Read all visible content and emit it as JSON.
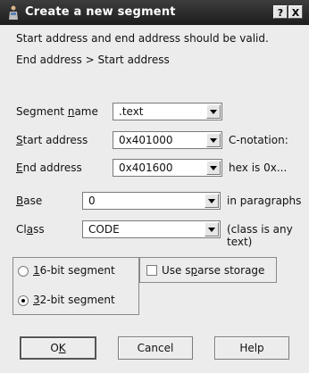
{
  "window": {
    "title": "Create a new segment",
    "help_label": "?",
    "close_label": "X"
  },
  "message": {
    "line1": "Start address and end address should be valid.",
    "line2": "End address > Start address"
  },
  "fields": {
    "segment_name": {
      "label_pre": "Segment ",
      "label_accel": "n",
      "label_post": "ame",
      "value": ".text"
    },
    "start_address": {
      "label_accel": "S",
      "label_post": "tart address",
      "value": "0x401000",
      "hint": "C-notation:"
    },
    "end_address": {
      "label_accel": "E",
      "label_post": "nd address",
      "value": "0x401600",
      "hint": "hex is 0x..."
    },
    "base": {
      "label_accel": "B",
      "label_post": "ase",
      "value": "0",
      "hint": "in paragraphs"
    },
    "class": {
      "label_pre": "Cl",
      "label_accel": "a",
      "label_post": "ss",
      "value": "CODE",
      "hint": "(class is any text)"
    }
  },
  "bitness": {
    "option16": {
      "label_accel": "1",
      "label_post": "6-bit segment",
      "selected": false
    },
    "option32": {
      "label_accel": "3",
      "label_post": "2-bit segment",
      "selected": true
    }
  },
  "sparse": {
    "label_pre": "Use s",
    "label_accel": "p",
    "label_post": "arse storage",
    "checked": false
  },
  "buttons": {
    "ok": {
      "label_pre": "O",
      "label_accel": "K"
    },
    "cancel": "Cancel",
    "help": "Help"
  },
  "icons": {
    "app": "ida-app-icon",
    "dropdown": "chevron-down-icon"
  },
  "colors": {
    "titlebar": "#2a2a2a",
    "background": "#ececec"
  }
}
